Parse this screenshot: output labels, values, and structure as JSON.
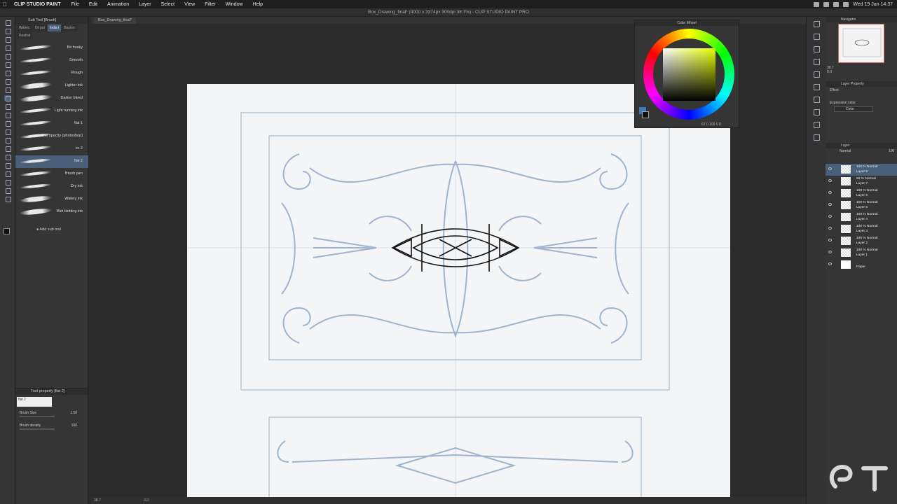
{
  "menubar": {
    "app_name": "CLIP STUDIO PAINT",
    "items": [
      "File",
      "Edit",
      "Animation",
      "Layer",
      "Select",
      "View",
      "Filter",
      "Window",
      "Help"
    ],
    "clock": "Wed 19 Jan 14:37"
  },
  "window": {
    "title": "Box_Drawing_final* (4000 x 3374px 300dpi 38.7%) - CLIP STUDIO PAINT PRO",
    "tab": "Box_Drawing_final*"
  },
  "subtool": {
    "header": "Sub Tool [Brush]",
    "groups": [
      "Waterc",
      "Oil pai",
      "India i",
      "Baston",
      "Realisti"
    ],
    "active_group": "India i",
    "brushes": [
      {
        "name": "Bit husky"
      },
      {
        "name": "Smooth"
      },
      {
        "name": "Rough"
      },
      {
        "name": "Lighter ink"
      },
      {
        "name": "Darker bleed"
      },
      {
        "name": "Light running ink"
      },
      {
        "name": "flat 1"
      },
      {
        "name": "round opacity (photoshop)"
      },
      {
        "name": "oc 2"
      },
      {
        "name": "flat 2"
      },
      {
        "name": "Brush pen"
      },
      {
        "name": "Dry ink"
      },
      {
        "name": "Watery ink"
      },
      {
        "name": "Wet blotting ink"
      }
    ],
    "selected_brush": "flat 2",
    "add_label": "Add sub tool"
  },
  "tool_property": {
    "header": "Tool property [flat 2]",
    "preview_label": "flat 2",
    "brush_size_label": "Brush Size",
    "brush_size_value": "1.50",
    "brush_density_label": "Brush density",
    "brush_density_value": "100"
  },
  "status": {
    "zoom": "38.7",
    "angle": "0.0"
  },
  "color_wheel": {
    "header": "Color Wheel",
    "readout": "67 0 100 0 0",
    "main_color": "#111111",
    "sub_color": "#3c79b8"
  },
  "navigator": {
    "header": "Navigator",
    "zoom": "38.7",
    "rotation": "0.0"
  },
  "layer_property": {
    "header": "Layer Property",
    "effect_label": "Effect",
    "expression_label": "Expression color",
    "expression_value": "Color"
  },
  "layers": {
    "header": "Layer",
    "blend_mode": "Normal",
    "opacity": "100",
    "rows": [
      {
        "mode": "100 % Normal",
        "name": "Layer 8",
        "selected": true
      },
      {
        "mode": "60 % Normal",
        "name": "Layer 7",
        "selected": false
      },
      {
        "mode": "100 % Normal",
        "name": "Layer 6",
        "selected": false
      },
      {
        "mode": "100 % Normal",
        "name": "Layer 5",
        "selected": false
      },
      {
        "mode": "100 % Normal",
        "name": "Layer 4",
        "selected": false
      },
      {
        "mode": "100 % Normal",
        "name": "Layer 3",
        "selected": false
      },
      {
        "mode": "100 % Normal",
        "name": "Layer 2",
        "selected": false
      },
      {
        "mode": "100 % Normal",
        "name": "Layer 1",
        "selected": false
      },
      {
        "mode": "",
        "name": "Paper",
        "selected": false
      }
    ]
  },
  "colors": {
    "accent": "#4a5f7a",
    "sketch_line": "#9fb4cc",
    "ink_line": "#111111"
  }
}
